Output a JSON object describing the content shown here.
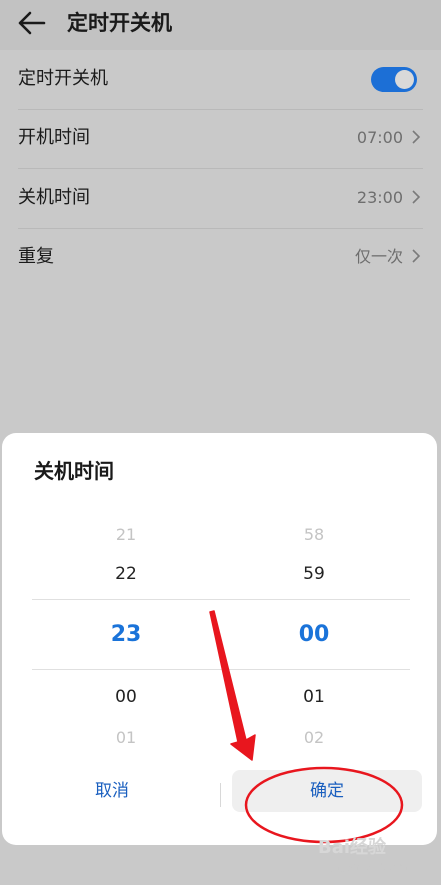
{
  "header": {
    "title": "定时开关机"
  },
  "settings": {
    "toggle_row": {
      "label": "定时开关机",
      "enabled": true
    },
    "power_on": {
      "label": "开机时间",
      "value": "07:00"
    },
    "power_off": {
      "label": "关机时间",
      "value": "23:00"
    },
    "repeat": {
      "label": "重复",
      "value": "仅一次"
    }
  },
  "dialog": {
    "title": "关机时间",
    "hours": {
      "far_above": "21",
      "above": "22",
      "selected": "23",
      "below": "00",
      "far_below": "01"
    },
    "minutes": {
      "far_above": "58",
      "above": "59",
      "selected": "00",
      "below": "01",
      "far_below": "02"
    },
    "cancel_label": "取消",
    "confirm_label": "确定"
  },
  "colors": {
    "accent": "#1a73d9",
    "toggle_on": "#1c6fd6",
    "annotation": "#e8161e"
  },
  "watermark": {
    "text": "Bai经验",
    "url": "jingyan.baidu.com"
  }
}
